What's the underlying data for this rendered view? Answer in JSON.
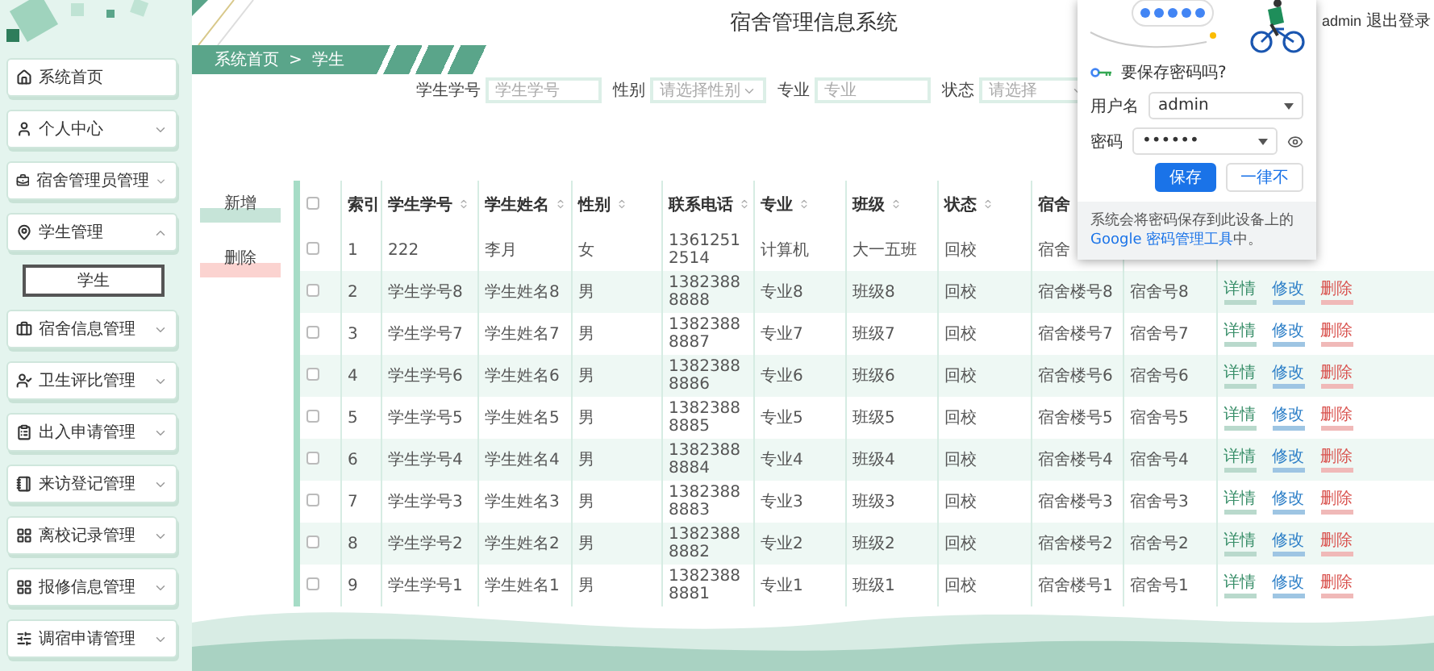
{
  "app": {
    "title": "宿舍管理信息系统",
    "user": "admin",
    "logout": "退出登录"
  },
  "sidebar": {
    "items": [
      {
        "kind": "link",
        "label": "系统首页"
      },
      {
        "kind": "group",
        "label": "个人中心",
        "expanded": false
      },
      {
        "kind": "group",
        "label": "宿舍管理员管理",
        "expanded": false
      },
      {
        "kind": "group",
        "label": "学生管理",
        "expanded": true,
        "children": [
          {
            "label": "学生",
            "selected": true
          }
        ]
      },
      {
        "kind": "group",
        "label": "宿舍信息管理",
        "expanded": false
      },
      {
        "kind": "group",
        "label": "卫生评比管理",
        "expanded": false
      },
      {
        "kind": "group",
        "label": "出入申请管理",
        "expanded": false
      },
      {
        "kind": "group",
        "label": "来访登记管理",
        "expanded": false
      },
      {
        "kind": "group",
        "label": "离校记录管理",
        "expanded": false
      },
      {
        "kind": "group",
        "label": "报修信息管理",
        "expanded": false
      },
      {
        "kind": "group",
        "label": "调宿申请管理",
        "expanded": false
      }
    ]
  },
  "breadcrumb": {
    "items": [
      "系统首页",
      "学生"
    ],
    "separator": ">"
  },
  "filters": [
    {
      "kind": "input",
      "label": "学生学号",
      "placeholder": "学生学号"
    },
    {
      "kind": "select",
      "label": "性别",
      "placeholder": "请选择性别"
    },
    {
      "kind": "input",
      "label": "专业",
      "placeholder": "专业"
    },
    {
      "kind": "select",
      "label": "状态",
      "placeholder": "请选择"
    }
  ],
  "buttons": [
    {
      "kind": "add",
      "label": "新增"
    },
    {
      "kind": "delete",
      "label": "删除"
    }
  ],
  "table": {
    "all_checked": false,
    "columns": [
      {
        "label": "索引",
        "sortable": false
      },
      {
        "label": "学生学号",
        "sortable": true
      },
      {
        "label": "学生姓名",
        "sortable": true
      },
      {
        "label": "性别",
        "sortable": true
      },
      {
        "label": "联系电话",
        "sortable": true
      },
      {
        "label": "专业",
        "sortable": true
      },
      {
        "label": "班级",
        "sortable": true
      },
      {
        "label": "状态",
        "sortable": true
      },
      {
        "label": "宿舍",
        "sortable": false
      }
    ],
    "rows": [
      {
        "checked": false,
        "cells": [
          "1",
          "222",
          "李月",
          "女",
          "13612512514",
          "计算机",
          "大一五班",
          "回校",
          "宿舍"
        ],
        "actions": []
      },
      {
        "checked": false,
        "cells": [
          "2",
          "学生学号8",
          "学生姓名8",
          "男",
          "13823888888",
          "专业8",
          "班级8",
          "回校",
          "宿舍楼号8",
          "宿舍号8"
        ],
        "actions": [
          "详情",
          "修改",
          "删除"
        ]
      },
      {
        "checked": false,
        "cells": [
          "3",
          "学生学号7",
          "学生姓名7",
          "男",
          "13823888887",
          "专业7",
          "班级7",
          "回校",
          "宿舍楼号7",
          "宿舍号7"
        ],
        "actions": [
          "详情",
          "修改",
          "删除"
        ]
      },
      {
        "checked": false,
        "cells": [
          "4",
          "学生学号6",
          "学生姓名6",
          "男",
          "13823888886",
          "专业6",
          "班级6",
          "回校",
          "宿舍楼号6",
          "宿舍号6"
        ],
        "actions": [
          "详情",
          "修改",
          "删除"
        ]
      },
      {
        "checked": false,
        "cells": [
          "5",
          "学生学号5",
          "学生姓名5",
          "男",
          "13823888885",
          "专业5",
          "班级5",
          "回校",
          "宿舍楼号5",
          "宿舍号5"
        ],
        "actions": [
          "详情",
          "修改",
          "删除"
        ]
      },
      {
        "checked": false,
        "cells": [
          "6",
          "学生学号4",
          "学生姓名4",
          "男",
          "13823888884",
          "专业4",
          "班级4",
          "回校",
          "宿舍楼号4",
          "宿舍号4"
        ],
        "actions": [
          "详情",
          "修改",
          "删除"
        ]
      },
      {
        "checked": false,
        "cells": [
          "7",
          "学生学号3",
          "学生姓名3",
          "男",
          "13823888883",
          "专业3",
          "班级3",
          "回校",
          "宿舍楼号3",
          "宿舍号3"
        ],
        "actions": [
          "详情",
          "修改",
          "删除"
        ]
      },
      {
        "checked": false,
        "cells": [
          "8",
          "学生学号2",
          "学生姓名2",
          "男",
          "13823888882",
          "专业2",
          "班级2",
          "回校",
          "宿舍楼号2",
          "宿舍号2"
        ],
        "actions": [
          "详情",
          "修改",
          "删除"
        ]
      },
      {
        "checked": false,
        "cells": [
          "9",
          "学生学号1",
          "学生姓名1",
          "男",
          "13823888881",
          "专业1",
          "班级1",
          "回校",
          "宿舍楼号1",
          "宿舍号1"
        ],
        "actions": [
          "详情",
          "修改",
          "删除"
        ]
      }
    ]
  },
  "password_prompt": {
    "title": "要保存密码吗?",
    "username_label": "用户名",
    "username": "admin",
    "password_label": "密码",
    "password": "••••••",
    "save": "保存",
    "never": "一律不",
    "note": "系统会将密码保存到此设备上的 ",
    "note_link": "Google 密码管理工具",
    "note_end": "中。"
  }
}
